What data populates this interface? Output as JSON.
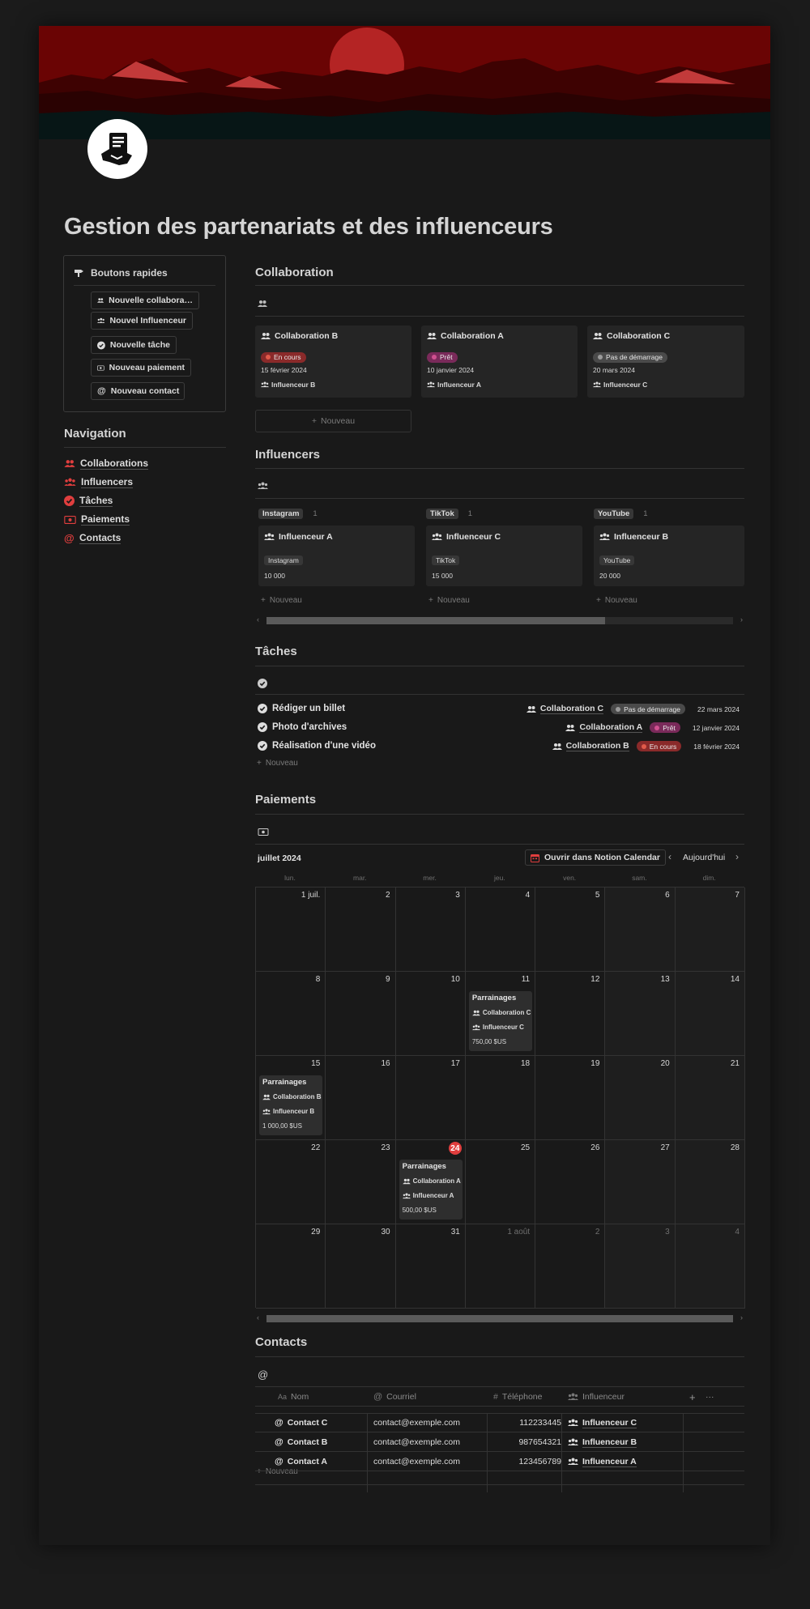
{
  "title": "Gestion des partenariats et des influenceurs",
  "colors": {
    "accent": "#e03e3e",
    "background": "#191919",
    "card": "#252525",
    "in_progress": "#8a2a2a",
    "ready": "#7a2a5a",
    "not_started": "#4a4a4a"
  },
  "quick_buttons": {
    "title": "Boutons rapides",
    "icon": "pointing-hand-icon",
    "items": [
      {
        "label": "Nouvelle collabora…",
        "icon": "people-icon"
      },
      {
        "label": "Nouvel Influenceur",
        "icon": "group-icon"
      },
      {
        "label": "Nouvelle tâche",
        "icon": "check-circle-icon"
      },
      {
        "label": "Nouveau paiement",
        "icon": "money-icon"
      },
      {
        "label": "Nouveau contact",
        "icon": "at-icon"
      }
    ]
  },
  "navigation": {
    "title": "Navigation",
    "items": [
      {
        "label": "Collaborations",
        "icon": "people-icon"
      },
      {
        "label": "Influencers",
        "icon": "group-icon"
      },
      {
        "label": "Tâches",
        "icon": "check-circle-icon"
      },
      {
        "label": "Paiements",
        "icon": "money-icon"
      },
      {
        "label": "Contacts",
        "icon": "at-icon"
      }
    ]
  },
  "collaboration": {
    "title": "Collaboration",
    "cards": [
      {
        "name": "Collaboration B",
        "status": "En cours",
        "date": "15 février 2024",
        "influencer": "Influenceur B"
      },
      {
        "name": "Collaboration A",
        "status": "Prêt",
        "date": "10 janvier 2024",
        "influencer": "Influenceur A"
      },
      {
        "name": "Collaboration C",
        "status": "Pas de démarrage",
        "date": "20 mars 2024",
        "influencer": "Influenceur C"
      }
    ],
    "new_label": "Nouveau"
  },
  "influencers": {
    "title": "Influencers",
    "columns": [
      {
        "group": "Instagram",
        "count": "1",
        "name": "Influenceur A",
        "platform": "Instagram",
        "followers": "10 000"
      },
      {
        "group": "TikTok",
        "count": "1",
        "name": "Influenceur C",
        "platform": "TikTok",
        "followers": "15 000"
      },
      {
        "group": "YouTube",
        "count": "1",
        "name": "Influenceur B",
        "platform": "YouTube",
        "followers": "20 000"
      }
    ],
    "new_label": "Nouveau",
    "scroll_arrow_left": "‹",
    "scroll_arrow_right": "›"
  },
  "tasks": {
    "title": "Tâches",
    "items": [
      {
        "name": "Rédiger un billet",
        "collab": "Collaboration C",
        "status": "Pas de démarrage",
        "date": "22 mars 2024"
      },
      {
        "name": "Photo d'archives",
        "collab": "Collaboration A",
        "status": "Prêt",
        "date": "12 janvier 2024"
      },
      {
        "name": "Réalisation d'une vidéo",
        "collab": "Collaboration B",
        "status": "En cours",
        "date": "18 février 2024"
      }
    ],
    "new_label": "Nouveau"
  },
  "payments": {
    "title": "Paiements",
    "month": "juillet 2024",
    "open_calendar": "Ouvrir dans Notion Calendar",
    "today": "Aujourd'hui",
    "prev_arrow": "‹",
    "next_arrow": "›",
    "weekdays": [
      "lun.",
      "mar.",
      "mer.",
      "jeu.",
      "ven.",
      "sam.",
      "dim."
    ],
    "weeks": [
      [
        "1 juil.",
        "2",
        "3",
        "4",
        "5",
        "6",
        "7"
      ],
      [
        "8",
        "9",
        "10",
        "11",
        "12",
        "13",
        "14"
      ],
      [
        "15",
        "16",
        "17",
        "18",
        "19",
        "20",
        "21"
      ],
      [
        "22",
        "23",
        "24",
        "25",
        "26",
        "27",
        "28"
      ],
      [
        "29",
        "30",
        "31",
        "1 août",
        "2",
        "3",
        "4"
      ]
    ],
    "today_day": "24",
    "events": [
      {
        "title": "Parrainages",
        "collab": "Collaboration C",
        "influencer": "Influenceur C",
        "amount": "750,00 $US",
        "day": "11"
      },
      {
        "title": "Parrainages",
        "collab": "Collaboration B",
        "influencer": "Influenceur B",
        "amount": "1 000,00 $US",
        "day": "15"
      },
      {
        "title": "Parrainages",
        "collab": "Collaboration A",
        "influencer": "Influenceur A",
        "amount": "500,00 $US",
        "day": "24"
      }
    ]
  },
  "contacts": {
    "title": "Contacts",
    "headers": {
      "name": "Nom",
      "name_prefix": "Aa",
      "email": "Courriel",
      "phone": "Téléphone",
      "influencer": "Influenceur",
      "add": "+",
      "more": "···",
      "phone_prefix": "#"
    },
    "rows": [
      {
        "name": "Contact C",
        "email": "contact@exemple.com",
        "phone": "112233445",
        "influencer": "Influenceur C"
      },
      {
        "name": "Contact B",
        "email": "contact@exemple.com",
        "phone": "987654321",
        "influencer": "Influenceur B"
      },
      {
        "name": "Contact A",
        "email": "contact@exemple.com",
        "phone": "123456789",
        "influencer": "Influenceur A"
      }
    ],
    "new_label": "Nouveau"
  }
}
